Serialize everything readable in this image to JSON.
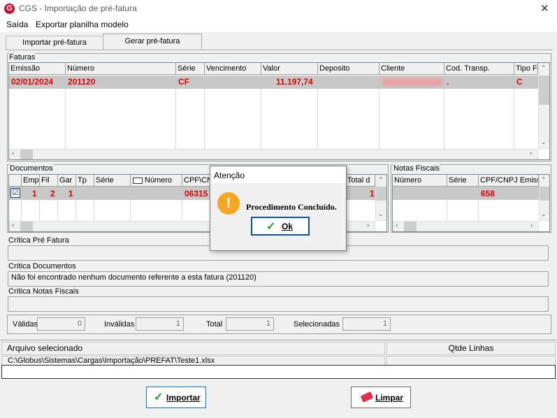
{
  "window": {
    "app_icon": "G",
    "title": "CGS - Importação de pré-fatura",
    "close_glyph": "✕"
  },
  "menu": {
    "items": [
      "Saída",
      "Exportar planilha modelo"
    ]
  },
  "tabs": [
    "Importar pré-fatura",
    "Gerar pré-fatura"
  ],
  "faturas": {
    "label": "Faturas",
    "columns": [
      "Emissão",
      "Número",
      "Série",
      "Vencimento",
      "Valor",
      "Deposito",
      "Cliente",
      "Cod. Transp.",
      "Tipo F"
    ],
    "row": {
      "emissao": "02/01/2024",
      "numero": "201120",
      "serie": "CF",
      "valor": "11.197,74",
      "cod_transp": ".",
      "tipo": "C"
    }
  },
  "documentos": {
    "label": "Documentos",
    "columns": [
      "Emp",
      "Fil",
      "Gar",
      "Tp",
      "Série",
      "Número",
      "CPF\\CN",
      "Total d"
    ],
    "row": {
      "emp": "1",
      "fil": "2",
      "gar": "1",
      "cpf": "06315",
      "total": "1"
    }
  },
  "notas": {
    "label": "Notas Fiscais",
    "columns": [
      "Número",
      "Série",
      "CPF/CNPJ Emiss"
    ],
    "row": {
      "cpf": "658"
    }
  },
  "critica": {
    "pre_fatura_label": "Crítica Pré Fatura",
    "documentos_label": "Crítica Documentos",
    "documentos_text": "Não foi encontrado nenhum documento referente a esta fatura (201120)",
    "notas_label": "Crítica Notas Fiscais"
  },
  "counts": {
    "validas_label": "Válidas",
    "validas": "0",
    "invalidas_label": "Inválidas",
    "invalidas": "1",
    "total_label": "Total",
    "total": "1",
    "selecionadas_label": "Selecionadas",
    "selecionadas": "1"
  },
  "file": {
    "arquivo_label": "Arquivo selecionado",
    "linhas_label": "Qtde Linhas",
    "path": "C:\\Globus\\Sistemas\\Cargas\\Importação\\PREFAT\\Teste1.xlsx"
  },
  "buttons": {
    "importar": "Importar",
    "limpar": "Limpar"
  },
  "dialog": {
    "title": "Atenção",
    "message": "Procedimento Concluído.",
    "ok": "Ok",
    "icon_glyph": "!"
  },
  "colors": {
    "accent_red": "#e00000",
    "warning": "#f5a623",
    "brand": "#c8102e"
  }
}
